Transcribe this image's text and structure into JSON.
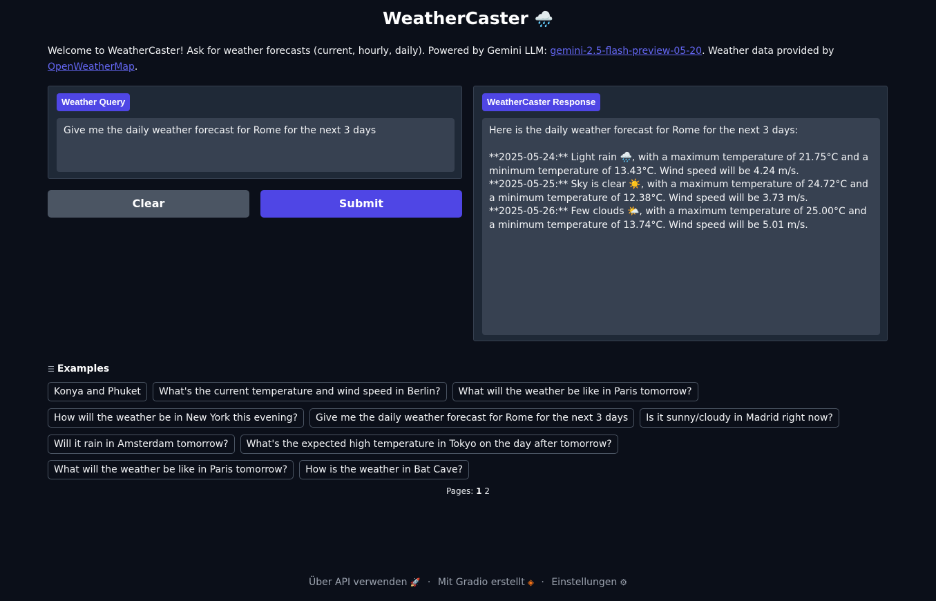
{
  "app": {
    "title": "WeatherCaster",
    "title_emoji": "🌧️"
  },
  "intro": {
    "text_1": "Welcome to WeatherCaster! Ask for weather forecasts (current, hourly, daily). Powered by Gemini LLM: ",
    "model_link": "gemini-2.5-flash-preview-05-20",
    "text_2": ". Weather data provided by ",
    "provider_link": "OpenWeatherMap",
    "text_3": "."
  },
  "query": {
    "label": "Weather Query",
    "value": "Give me the daily weather forecast for Rome for the next 3 days"
  },
  "response": {
    "label": "WeatherCaster Response",
    "text": "Here is the daily weather forecast for Rome for the next 3 days:\n\n**2025-05-24:** Light rain 🌧️, with a maximum temperature of 21.75°C and a minimum temperature of 13.43°C. Wind speed will be 4.24 m/s.\n**2025-05-25:** Sky is clear ☀️, with a maximum temperature of 24.72°C and a minimum temperature of 12.38°C. Wind speed will be 3.73 m/s.\n**2025-05-26:** Few clouds 🌤️, with a maximum temperature of 25.00°C and a minimum temperature of 13.74°C. Wind speed will be 5.01 m/s."
  },
  "buttons": {
    "clear": "Clear",
    "submit": "Submit"
  },
  "examples": {
    "heading": "Examples",
    "rows": [
      [
        "Konya and Phuket",
        "What's the current temperature and wind speed in Berlin?",
        "What will the weather be like in Paris tomorrow?"
      ],
      [
        "How will the weather be in New York this evening?",
        "Give me the daily weather forecast for Rome for the next 3 days",
        "Is it sunny/cloudy in Madrid right now?"
      ],
      [
        "Will it rain in Amsterdam tomorrow?",
        "What's the expected high temperature in Tokyo on the day after tomorrow?"
      ],
      [
        "What will the weather be like in Paris tomorrow?",
        "How is the weather in Bat Cave?"
      ]
    ]
  },
  "pagination": {
    "label": "Pages:",
    "current": "1",
    "other": "2"
  },
  "footer": {
    "api": "Über API verwenden",
    "gradio": "Mit Gradio erstellt",
    "settings": "Einstellungen",
    "separator": "·"
  },
  "icons": {
    "api": "rocket-icon",
    "gradio": "gradio-logo-icon",
    "settings": "gear-icon",
    "examples": "list-icon"
  },
  "colors": {
    "accent": "#4f46e5",
    "background": "#0b0f19",
    "panel": "#1f2937",
    "link": "#6366f1"
  }
}
